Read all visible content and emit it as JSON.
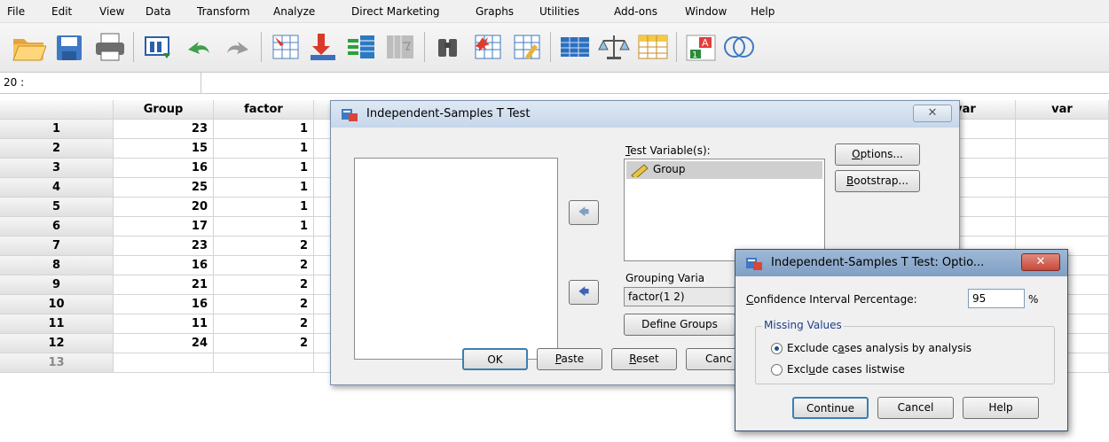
{
  "menu": [
    {
      "label": "File"
    },
    {
      "label": "Edit"
    },
    {
      "label": "View"
    },
    {
      "label": "Data"
    },
    {
      "label": "Transform"
    },
    {
      "label": "Analyze"
    },
    {
      "label": "Direct Marketing"
    },
    {
      "label": "Graphs"
    },
    {
      "label": "Utilities"
    },
    {
      "label": "Add-ons"
    },
    {
      "label": "Window"
    },
    {
      "label": "Help"
    }
  ],
  "toolbar_icons": [
    "open-folder-icon",
    "save-icon",
    "print-icon",
    "recall-dialog-icon",
    "undo-icon",
    "redo-icon",
    "goto-case-icon",
    "goto-variable-icon",
    "variables-icon",
    "run-descriptives-icon",
    "find-icon",
    "insert-cases-icon",
    "insert-variable-icon",
    "split-file-icon",
    "weight-cases-icon",
    "select-cases-icon",
    "value-labels-icon",
    "use-sets-icon"
  ],
  "cell_reference": "20 :",
  "grid": {
    "headers": [
      "Group",
      "factor",
      "var",
      "var"
    ],
    "rows": [
      {
        "n": "1",
        "group": "23",
        "factor": "1"
      },
      {
        "n": "2",
        "group": "15",
        "factor": "1"
      },
      {
        "n": "3",
        "group": "16",
        "factor": "1"
      },
      {
        "n": "4",
        "group": "25",
        "factor": "1"
      },
      {
        "n": "5",
        "group": "20",
        "factor": "1"
      },
      {
        "n": "6",
        "group": "17",
        "factor": "1"
      },
      {
        "n": "7",
        "group": "23",
        "factor": "2"
      },
      {
        "n": "8",
        "group": "16",
        "factor": "2"
      },
      {
        "n": "9",
        "group": "21",
        "factor": "2"
      },
      {
        "n": "10",
        "group": "16",
        "factor": "2"
      },
      {
        "n": "11",
        "group": "11",
        "factor": "2"
      },
      {
        "n": "12",
        "group": "24",
        "factor": "2"
      },
      {
        "n": "13",
        "group": "",
        "factor": ""
      }
    ]
  },
  "dialog_main": {
    "title": "Independent-Samples T Test",
    "test_variables_label": "Test Variable(s):",
    "test_variables": [
      "Group"
    ],
    "grouping_label": "Grouping Varia",
    "grouping_value": "factor(1 2)",
    "define_groups": "Define Groups",
    "options": "Options...",
    "bootstrap": "Bootstrap...",
    "ok": "OK",
    "paste": "Paste",
    "reset": "Reset",
    "cancel": "Canc"
  },
  "dialog_options": {
    "title": "Independent-Samples T Test: Optio...",
    "ci_label": "Confidence Interval Percentage:",
    "ci_value": "95",
    "ci_unit": "%",
    "missing_label": "Missing Values",
    "opt_analysis": "Exclude cases analysis by analysis",
    "opt_listwise": "Exclude cases listwise",
    "selected": "analysis",
    "continue": "Continue",
    "cancel": "Cancel",
    "help": "Help"
  },
  "colors": {
    "accent": "#3c7fb1",
    "close_red": "#c9483b"
  }
}
